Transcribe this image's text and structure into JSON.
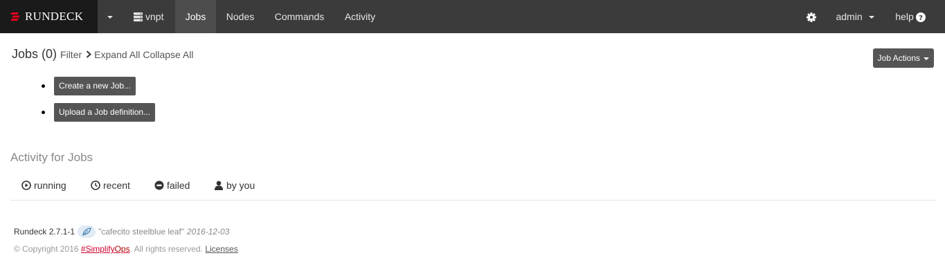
{
  "navbar": {
    "brand": "RUNDECK",
    "project": "vnpt",
    "items": [
      "Jobs",
      "Nodes",
      "Commands",
      "Activity"
    ],
    "user": "admin",
    "help": "help"
  },
  "jobs": {
    "title": "Jobs",
    "count": "(0)",
    "filter": "Filter",
    "expand_all": "Expand All",
    "collapse_all": "Collapse All",
    "job_actions": "Job Actions",
    "create_job": "Create a new Job...",
    "upload_job": "Upload a Job definition..."
  },
  "activity": {
    "title": "Activity for Jobs",
    "tabs": [
      "running",
      "recent",
      "failed",
      "by you"
    ]
  },
  "footer": {
    "version": "Rundeck 2.7.1-1",
    "codename": "\"cafecito steelblue leaf\"",
    "date": "2016-12-03",
    "copyright": "© Copyright 2016",
    "simplify_prefix": "#Simplify",
    "simplify_suffix": "Ops",
    "rights": ". All rights reserved.",
    "licenses": "Licenses"
  },
  "colors": {
    "navbar_bg": "#3b3b3b",
    "brand_bg": "#1a1a1a",
    "brand_accent": "#e8001c",
    "button_bg": "#555555",
    "simplify_red": "#c9002c"
  }
}
